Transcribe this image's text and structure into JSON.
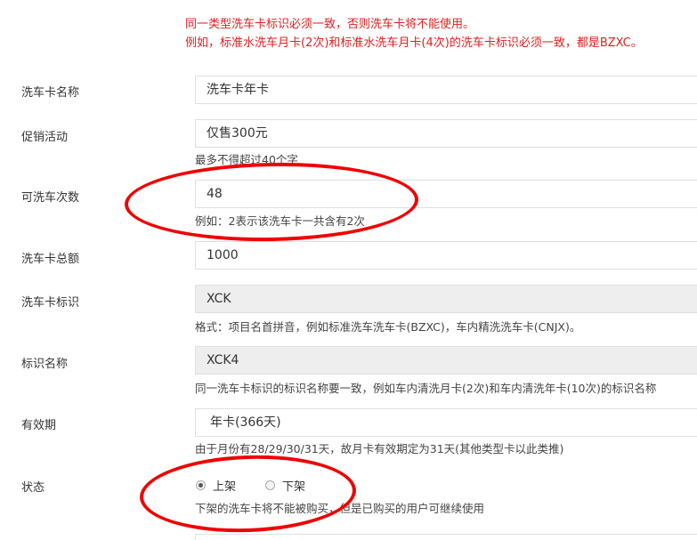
{
  "notice": {
    "line1": "同一类型洗车卡标识必须一致，否则洗车卡将不能使用。",
    "line2": "例如，标准水洗车月卡(2次)和标准水洗车月卡(4次)的洗车卡标识必须一致，都是BZXC。"
  },
  "fields": {
    "name": {
      "label": "洗车卡名称",
      "value": "洗车卡年卡"
    },
    "promo": {
      "label": "促销活动",
      "value": "仅售300元",
      "help": "最多不得超过40个字"
    },
    "times": {
      "label": "可洗车次数",
      "value": "48",
      "help": "例如：2表示该洗车卡一共含有2次"
    },
    "total": {
      "label": "洗车卡总额",
      "value": "1000"
    },
    "code": {
      "label": "洗车卡标识",
      "value": "XCK",
      "help": "格式：项目名首拼音，例如标准洗车洗车卡(BZXC)，车内精洗洗车卡(CNJX)。"
    },
    "code_name": {
      "label": "标识名称",
      "value": "XCK4",
      "help": "同一洗车卡标识的标识名称要一致，例如车内清洗月卡(2次)和车内清洗年卡(10次)的标识名称"
    },
    "validity": {
      "label": "有效期",
      "value": "年卡(366天)",
      "help": "由于月份有28/29/30/31天，故月卡有效期定为31天(其他类型卡以此类推)"
    },
    "status": {
      "label": "状态",
      "options": [
        {
          "label": "上架",
          "checked": true
        },
        {
          "label": "下架",
          "checked": false
        }
      ],
      "help": "下架的洗车卡将不能被购买，但是已购买的用户可继续使用"
    }
  },
  "annotation_color": "#f00000"
}
